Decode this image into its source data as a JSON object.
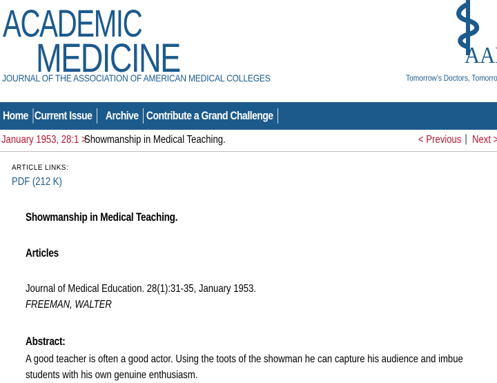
{
  "masthead": {
    "logo_line1": "ACADEMIC",
    "logo_line2": "MEDICINE",
    "journal_subtitle": "JOURNAL OF THE ASSOCIATION OF AMERICAN MEDICAL COLLEGES",
    "aamc_text": "AAM",
    "aamc_tagline": "Tomorrow’s Doctors, Tomorrow’s",
    "brand_color": "#1c5a8c"
  },
  "nav": {
    "items": [
      {
        "label": "Home"
      },
      {
        "label": "Current Issue"
      },
      {
        "label": "Archive"
      },
      {
        "label": "Contribute a Grand Challenge"
      }
    ]
  },
  "breadcrumb": {
    "issue": "January 1953, 28:1 >",
    "title": "Showmanship in Medical Teaching.",
    "previous": "< Previous",
    "separator": "|",
    "next": "Next >",
    "link_color": "#b2162e"
  },
  "article_links": {
    "heading": "ARTICLE LINKS:",
    "pdf": "PDF (212 K)"
  },
  "article": {
    "title": "Showmanship in Medical Teaching.",
    "section": "Articles",
    "citation": "Journal of Medical Education. 28(1):31-35, January 1953.",
    "author": "FREEMAN, WALTER",
    "abstract_heading": "Abstract:",
    "abstract_text": "A good teacher is often a good actor. Using the toots of the showman he can capture his audience and imbue students with his own genuine enthusiasm."
  }
}
